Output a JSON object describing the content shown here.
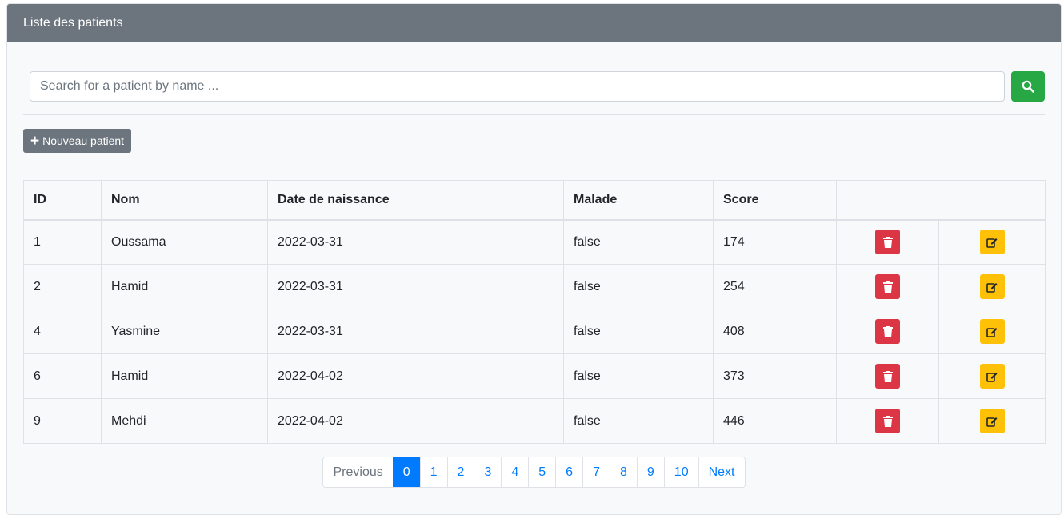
{
  "header": {
    "title": "Liste des patients"
  },
  "search": {
    "placeholder": "Search for a patient by name ..."
  },
  "toolbar": {
    "new_patient_label": "Nouveau patient"
  },
  "table": {
    "columns": [
      "ID",
      "Nom",
      "Date de naissance",
      "Malade",
      "Score",
      ""
    ],
    "rows": [
      {
        "id": "1",
        "nom": "Oussama",
        "date": "2022-03-31",
        "malade": "false",
        "score": "174"
      },
      {
        "id": "2",
        "nom": "Hamid",
        "date": "2022-03-31",
        "malade": "false",
        "score": "254"
      },
      {
        "id": "4",
        "nom": "Yasmine",
        "date": "2022-03-31",
        "malade": "false",
        "score": "408"
      },
      {
        "id": "6",
        "nom": "Hamid",
        "date": "2022-04-02",
        "malade": "false",
        "score": "373"
      },
      {
        "id": "9",
        "nom": "Mehdi",
        "date": "2022-04-02",
        "malade": "false",
        "score": "446"
      }
    ]
  },
  "pagination": {
    "previous": "Previous",
    "pages": [
      "0",
      "1",
      "2",
      "3",
      "4",
      "5",
      "6",
      "7",
      "8",
      "9",
      "10"
    ],
    "active": "0",
    "next": "Next"
  },
  "icons": {
    "search": "search-icon",
    "plus": "plus-icon",
    "delete": "trash-icon",
    "edit": "edit-icon"
  },
  "colors": {
    "header": "#6c757d",
    "search_button": "#28a745",
    "delete": "#dc3545",
    "edit": "#ffc107",
    "active_page": "#007bff"
  }
}
